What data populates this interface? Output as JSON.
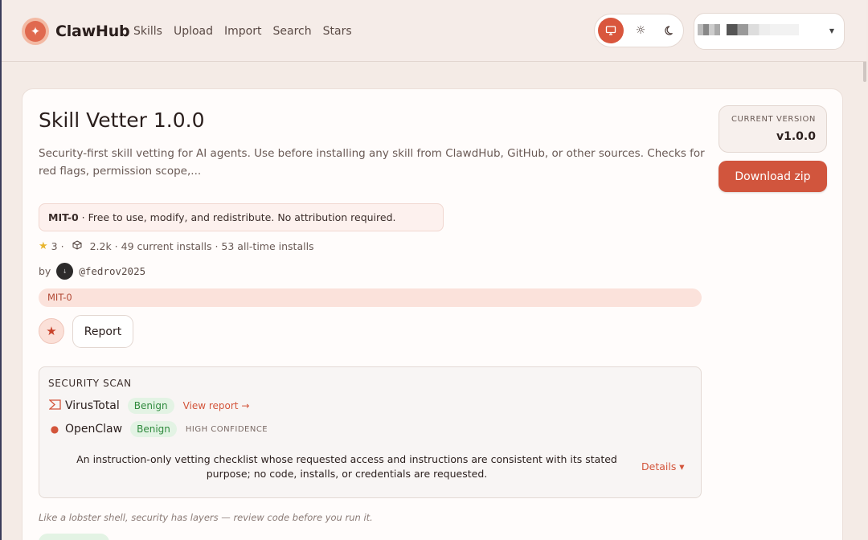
{
  "header": {
    "brand": "ClawHub",
    "nav": [
      "Skills",
      "Upload",
      "Import",
      "Search",
      "Stars"
    ],
    "theme_options": [
      "monitor-icon",
      "sun-icon",
      "moon-icon"
    ],
    "theme_active": "system"
  },
  "skill": {
    "title": "Skill Vetter 1.0.0",
    "description": "Security-first skill vetting for AI agents. Use before installing any skill from ClawdHub, GitHub, or other sources. Checks for red flags, permission scope,...",
    "license_name": "MIT-0",
    "license_text": " · Free to use, modify, and redistribute. No attribution required.",
    "stars": "3",
    "stats_text": "2.2k · 49 current installs · 53 all-time installs",
    "by_label": "by",
    "author": "@fedrov2025",
    "tag": "MIT-0",
    "report_label": "Report",
    "tagline": "Like a lobster shell, security has layers — review code before you run it."
  },
  "security": {
    "heading": "SECURITY SCAN",
    "virustotal": {
      "name": "VirusTotal",
      "status": "Benign",
      "link": "View report →"
    },
    "openclaw": {
      "name": "OpenClaw",
      "status": "Benign",
      "confidence": "HIGH CONFIDENCE"
    },
    "summary": "An instruction-only vetting checklist whose requested access and instructions are consistent with its stated purpose; no code, installs, or credentials are requested.",
    "details_label": "Details ▾"
  },
  "sidebar": {
    "version_label": "CURRENT VERSION",
    "version": "v1.0.0",
    "download_label": "Download zip"
  },
  "colors": {
    "accent": "#d1553d",
    "benign_bg": "#e3f3e4",
    "benign_text": "#2f8a3d"
  }
}
